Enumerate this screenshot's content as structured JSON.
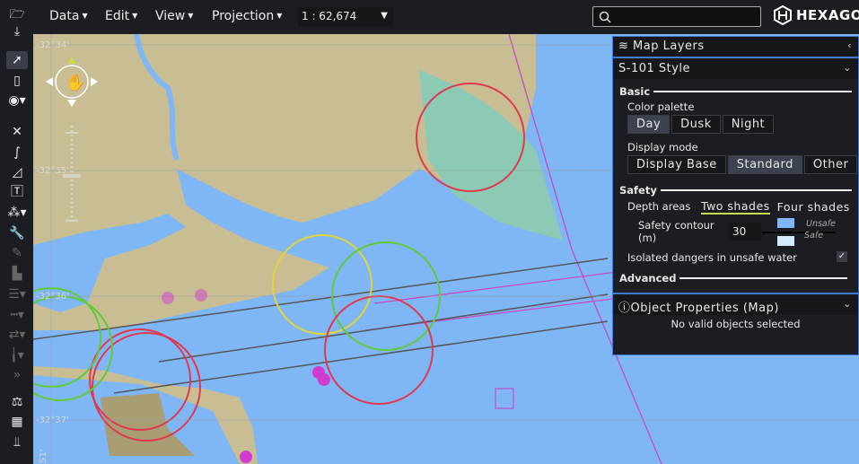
{
  "menu": {
    "data": "Data",
    "edit": "Edit",
    "view": "View",
    "projection": "Projection"
  },
  "scale": "1 : 62,674",
  "search": {
    "placeholder": ""
  },
  "logo": "HEXAGON",
  "toolbar": [
    "folder-open-icon",
    "download-icon",
    "select-arrow-icon",
    "ruler-icon",
    "eye-icon",
    "close-icon",
    "polyline-icon",
    "polygon-icon",
    "text-icon",
    "shapes-icon",
    "wrench-icon",
    "brush-icon",
    "document-icon",
    "line-style-icon",
    "dashed-line-icon",
    "arrows-icon",
    "pin-icon",
    "forward-icon",
    "layers-icon",
    "table-icon",
    "chart-icon"
  ],
  "map": {
    "lat_labels": [
      "-32°34'",
      "-32°35'",
      "-32°36'",
      "-32°37'"
    ],
    "lon_labels": [
      "51'"
    ],
    "colors": {
      "land": "#c9be93",
      "water": "#7fb6f5",
      "shallow": "#8ccab5",
      "red": "#e0394d",
      "green": "#5fcb3a",
      "yellow": "#e2d43a",
      "magenta": "#d23bd0"
    }
  },
  "panel": {
    "map_layers": "Map Layers",
    "style_title": "S-101 Style",
    "basic": "Basic",
    "color_palette": "Color palette",
    "palette_options": [
      "Day",
      "Dusk",
      "Night"
    ],
    "palette_selected": "Day",
    "display_mode": "Display mode",
    "display_options": [
      "Display Base",
      "Standard",
      "Other"
    ],
    "display_selected": "Standard",
    "safety": "Safety",
    "depth_areas": "Depth areas",
    "depth_options": [
      "Two shades",
      "Four shades"
    ],
    "depth_selected": "Two shades",
    "safety_contour_label": "Safety contour (m)",
    "safety_contour_value": "30",
    "unsafe": "Unsafe",
    "safe": "Safe",
    "isolated_dangers": "Isolated dangers in unsafe water",
    "isolated_dangers_checked": true,
    "advanced": "Advanced",
    "object_properties": "Object Properties (Map)",
    "no_objects": "No valid objects selected"
  }
}
